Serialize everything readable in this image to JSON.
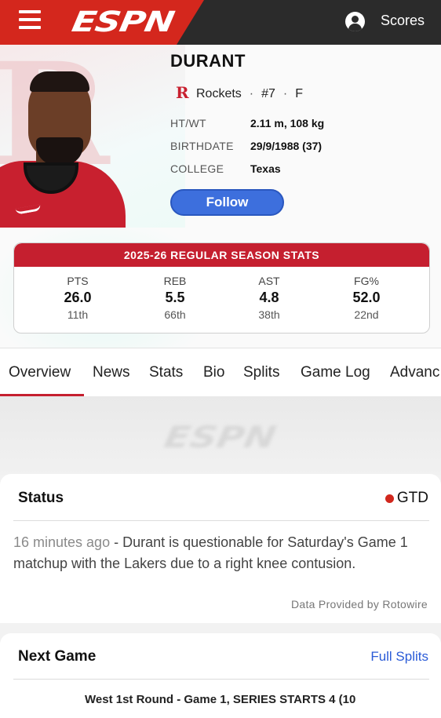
{
  "header": {
    "logo_text": "ESPN",
    "scores_label": "Scores",
    "brand_color": "#d4271d"
  },
  "player": {
    "name": "DURANT",
    "team": "Rockets",
    "number": "#7",
    "position": "F",
    "info": [
      {
        "label": "HT/WT",
        "value": "2.11 m, 108 kg"
      },
      {
        "label": "BIRTHDATE",
        "value": "29/9/1988 (37)"
      },
      {
        "label": "COLLEGE",
        "value": "Texas"
      }
    ],
    "follow_label": "Follow"
  },
  "season_stats": {
    "title": "2025-26 REGULAR SEASON STATS",
    "columns": [
      {
        "label": "PTS",
        "value": "26.0",
        "rank": "11th"
      },
      {
        "label": "REB",
        "value": "5.5",
        "rank": "66th"
      },
      {
        "label": "AST",
        "value": "4.8",
        "rank": "38th"
      },
      {
        "label": "FG%",
        "value": "52.0",
        "rank": "22nd"
      }
    ]
  },
  "tabs": [
    {
      "label": "Overview",
      "active": true
    },
    {
      "label": "News"
    },
    {
      "label": "Stats"
    },
    {
      "label": "Bio"
    },
    {
      "label": "Splits"
    },
    {
      "label": "Game Log"
    },
    {
      "label": "Advanc"
    }
  ],
  "ad": {
    "logo_text": "ESPN"
  },
  "status": {
    "title": "Status",
    "badge": "GTD",
    "time": "16 minutes ago",
    "note": " - Durant is questionable for Saturday's Game 1 matchup with the Lakers due to a right knee contusion.",
    "provider": "Data Provided by Rotowire"
  },
  "next_game": {
    "title": "Next Game",
    "link": "Full Splits",
    "series": "West 1st Round - Game 1, SERIES STARTS 4 (10"
  }
}
